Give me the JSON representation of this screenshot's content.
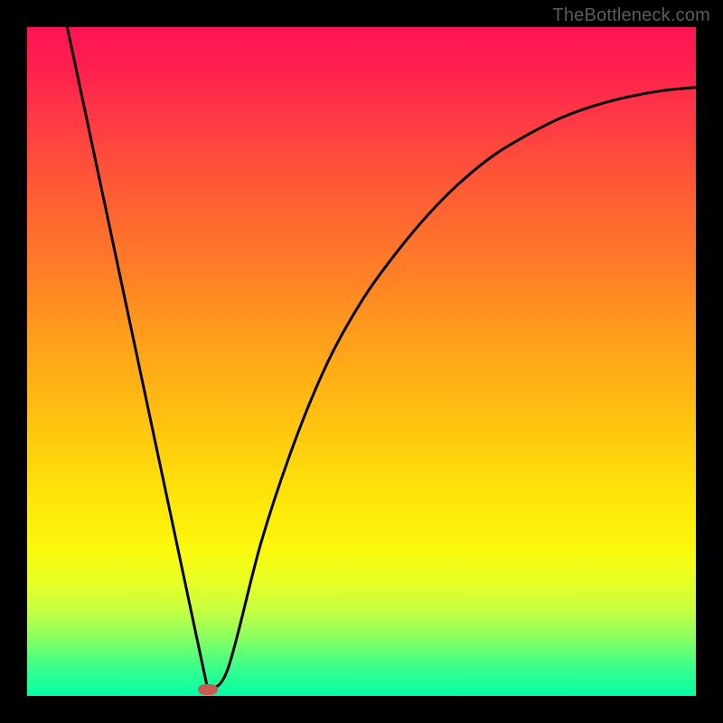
{
  "watermark": "TheBottleneck.com",
  "chart_data": {
    "type": "line",
    "title": "",
    "xlabel": "",
    "ylabel": "",
    "xlim": [
      0,
      100
    ],
    "ylim": [
      0,
      100
    ],
    "grid": false,
    "series": [
      {
        "name": "curve",
        "x": [
          6,
          27,
          30,
          35,
          40,
          45,
          50,
          55,
          60,
          65,
          70,
          75,
          80,
          85,
          90,
          95,
          100
        ],
        "y": [
          100,
          1,
          4,
          23,
          38,
          50,
          59,
          66,
          72,
          77,
          81,
          84,
          86.5,
          88.3,
          89.6,
          90.5,
          91
        ]
      }
    ],
    "marker": {
      "x": 27,
      "y": 1,
      "color": "#c95a4f"
    },
    "colors": {
      "top": "#ff1453",
      "mid": "#ffc60f",
      "bottom": "#05ffa5",
      "curve": "#000000",
      "marker": "#c95a4f",
      "frame": "#000000"
    }
  }
}
